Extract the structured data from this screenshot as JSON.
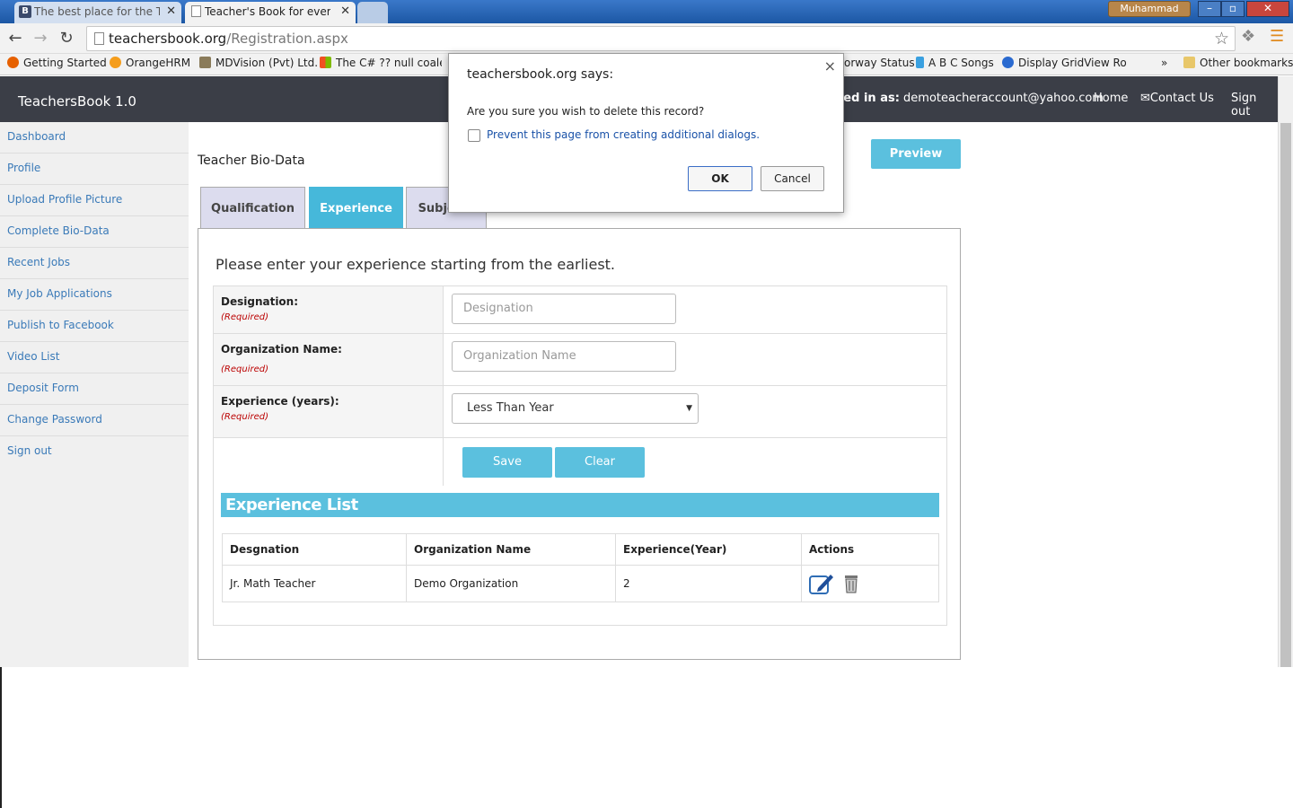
{
  "browser": {
    "tabs": [
      {
        "favicon": "B",
        "title": "The best place for the Tea"
      },
      {
        "favicon": "",
        "title": "Teacher's Book for every t"
      }
    ],
    "tab_close": "✕",
    "user": "Muhammad",
    "url_host": "teachersbook.org",
    "url_path": "/Registration.aspx",
    "bookmarks": [
      "Getting Started",
      "OrangeHRM",
      "MDVision (Pvt) Ltd.",
      "The C# ?? null coalesc",
      "orway Status",
      "A B C Songs",
      "Display GridView Row",
      "»",
      "Other bookmarks"
    ]
  },
  "site": {
    "brand": "TeachersBook 1.0",
    "logged_in_label": "ged in as:",
    "logged_in_email": "demoteacheraccount@yahoo.com",
    "nav": {
      "home": "Home",
      "contact": "Contact Us",
      "signout": "Sign out"
    }
  },
  "sidebar": {
    "items": [
      {
        "label": "Dashboard"
      },
      {
        "label": "Profile"
      },
      {
        "label": "Upload Profile Picture"
      },
      {
        "label": "Complete Bio-Data"
      },
      {
        "label": "Recent Jobs"
      },
      {
        "label": "My Job Applications"
      },
      {
        "label": "Publish to Facebook"
      },
      {
        "label": "Video List"
      },
      {
        "label": "Deposit Form"
      },
      {
        "label": "Change Password"
      },
      {
        "label": "Sign out"
      }
    ]
  },
  "main": {
    "title": "Teacher Bio-Data",
    "preview_label": "Preview",
    "tabs": [
      {
        "label": "Qualification"
      },
      {
        "label": "Experience"
      },
      {
        "label": "Subjects"
      }
    ],
    "instruction": "Please enter your experience starting from the earliest.",
    "form": {
      "designation_label": "Designation:",
      "designation_placeholder": "Designation",
      "org_label": "Organization Name:",
      "org_placeholder": "Organization Name",
      "exp_label": "Experience (years):",
      "exp_value": "Less Than Year",
      "required": "(Required)",
      "save_label": "Save",
      "clear_label": "Clear"
    },
    "list_title": "Experience List",
    "grid": {
      "headers": [
        "Desgnation",
        "Organization Name",
        "Experience(Year)",
        "Actions"
      ],
      "rows": [
        {
          "designation": "Jr. Math Teacher",
          "organization": "Demo Organization",
          "experience": "2"
        }
      ]
    }
  },
  "dialog": {
    "title": "teachersbook.org says:",
    "message": "Are you sure you wish to delete this record?",
    "checkbox_label": "Prevent this page from creating additional dialogs.",
    "ok": "OK",
    "cancel": "Cancel",
    "close": "×"
  },
  "colors": {
    "accent": "#5bc0de",
    "header_bg": "#3b3e47",
    "link": "#3a7ab8"
  }
}
